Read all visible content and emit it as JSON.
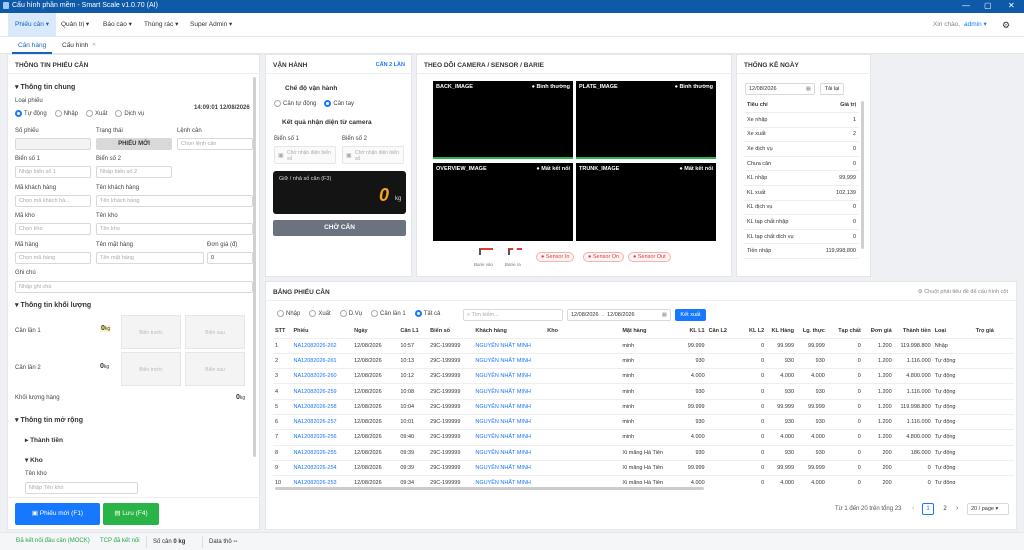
{
  "titlebar": {
    "title": "Cấu hình phần mềm - Smart Scale v1.0.70 (AI)",
    "min": "—",
    "max": "▢",
    "close": "✕"
  },
  "menu": {
    "items": [
      "Phiếu cân ▾",
      "Quản trị ▾",
      "Báo cáo ▾",
      "Thùng rác ▾",
      "Super Admin ▾"
    ],
    "greeting": "Xin chào,",
    "user": "admin ▾"
  },
  "tabs": {
    "items": [
      "Cân hàng",
      "Cấu hình"
    ],
    "close": "✕"
  },
  "left": {
    "title": "THÔNG TIN PHIẾU CÂN",
    "general": "Thông tin chung",
    "type_label": "Loại phiếu",
    "types": [
      "Tự động",
      "Nhập",
      "Xuất",
      "Dịch vụ"
    ],
    "datetime": "14:09:01 12/08/2026",
    "ticket_no_label": "Số phiếu",
    "status_label": "Trạng thái",
    "status_value": "PHIẾU MỚI",
    "cmd_label": "Lệnh cân",
    "cmd_ph": "Chọn lệnh cân",
    "plate1_label": "Biển số 1",
    "plate1_ph": "Nhập biển số 1",
    "plate2_label": "Biển số 2",
    "plate2_ph": "Nhập biển số 2",
    "cust_code_label": "Mã khách hàng",
    "cust_code_ph": "Chọn mã khách hà...",
    "cust_name_label": "Tên khách hàng",
    "cust_name_ph": "Tên khách hàng",
    "wh_code_label": "Mã kho",
    "wh_code_ph": "Chọn kho",
    "wh_name_label": "Tên kho",
    "wh_name_ph": "Tên kho",
    "goods_code_label": "Mã hàng",
    "goods_code_ph": "Chọn mã hàng",
    "goods_name_label": "Tên mặt hàng",
    "goods_name_ph": "Tên mặt hàng",
    "price_label": "Đơn giá (đ)",
    "price_value": "0",
    "note_label": "Ghi chú",
    "note_ph": "Nhập ghi chú",
    "weight_section": "Thông tin khối lượng",
    "w1_label": "Cân lần 1",
    "w1_value": "0",
    "w2_label": "Cân lần 2",
    "w2_value": "0",
    "unit": "kg",
    "bs_truoc": "Biển trước",
    "bs_sau": "Biển sau",
    "net_label": "Khối lượng hàng",
    "net_value": "0",
    "ext_section": "Thông tin mở rộng",
    "money": "Thành tiền",
    "kho": "Kho",
    "kho_name_label": "Tên kho",
    "kho_name_ph": "Nhập Tên kho",
    "new_btn": "Phiếu mới (F1)",
    "save_btn": "Lưu (F4)"
  },
  "op": {
    "title": "VẬN HÀNH",
    "mode_badge": "CÂN 2 LẦN",
    "mode_title": "Chế độ vận hành",
    "modes": [
      "Cân tự động",
      "Cân tay"
    ],
    "recog_title": "Kết quả nhận diện từ camera",
    "plate1": "Biển số 1",
    "plate2": "Biển số 2",
    "recog_ph": "Chờ nhận diện biển số",
    "hold_label": "Giữ / nhả số cân (F3)",
    "weight": "0",
    "unit": "kg",
    "wait_btn": "CHỜ CÂN"
  },
  "cams": {
    "title": "THEO DÕI CAMERA / SENSOR / BARIE",
    "items": [
      {
        "name": "BACK_IMAGE",
        "status": "● Bình thường"
      },
      {
        "name": "PLATE_IMAGE",
        "status": "● Bình thường"
      },
      {
        "name": "OVERVIEW_IMAGE",
        "status": "● Mất kết nối"
      },
      {
        "name": "TRUNK_IMAGE",
        "status": "● Mất kết nối"
      }
    ],
    "barrier_in": "Barie vào",
    "barrier_out": "Barie ra",
    "sensors": [
      "● Sensor In",
      "● Sensor On",
      "● Sensor Out"
    ]
  },
  "stats": {
    "title": "THỐNG KÊ NGÀY",
    "date": "12/08/2026",
    "reload": "Tải lại",
    "col1": "Tiêu chí",
    "col2": "Giá trị",
    "rows": [
      [
        "Xe nhập",
        "1"
      ],
      [
        "Xe xuất",
        "2"
      ],
      [
        "Xe dịch vụ",
        "0"
      ],
      [
        "Chưa cân",
        "0"
      ],
      [
        "KL nhập",
        "99,999"
      ],
      [
        "KL xuất",
        "102,139"
      ],
      [
        "KL dịch vụ",
        "0"
      ],
      [
        "KL tạp chất nhập",
        "0"
      ],
      [
        "KL tạp chất dịch vụ",
        "0"
      ],
      [
        "Tiền nhập",
        "119,998,800"
      ]
    ]
  },
  "grid": {
    "title": "BẢNG PHIẾU CÂN",
    "hint": "⚙ Chuột phải tiêu đề để cấu hình cột",
    "filters": [
      "Nhập",
      "Xuất",
      "D.Vụ",
      "Cân lần 1",
      "Tất cả"
    ],
    "search_ph": "Tìm kiếm...",
    "from": "12/08/2026",
    "to": "12/08/2026",
    "export": "Kết xuất",
    "headers": [
      "STT",
      "Phiếu",
      "Ngày",
      "Cân L1",
      "Biển số",
      "Khách hàng",
      "Kho",
      "Mặt hàng",
      "KL L1",
      "Cân L2",
      "KL L2",
      "KL Hàng",
      "Lg. thực",
      "Tạp chất",
      "Đơn giá",
      "Thành tiền",
      "Loại",
      "Trọ giá"
    ],
    "rows": [
      [
        "1",
        "NA12082026-262",
        "12/08/2026",
        "10:57",
        "29C-199999",
        "NGUYỄN NHẤT MINH",
        "",
        "minh",
        "99.999",
        "",
        "0",
        "99.999",
        "99.999",
        "0",
        "1.200",
        "119.998.800",
        "Nhập",
        ""
      ],
      [
        "2",
        "NA12082026-261",
        "12/08/2026",
        "10:13",
        "29C-199999",
        "NGUYỄN NHẤT MINH",
        "",
        "minh",
        "930",
        "",
        "0",
        "930",
        "930",
        "0",
        "1.200",
        "1.116.000",
        "Tự động",
        ""
      ],
      [
        "3",
        "NA12082026-260",
        "12/08/2026",
        "10:12",
        "29C-199999",
        "NGUYỄN NHẤT MINH",
        "",
        "minh",
        "4.000",
        "",
        "0",
        "4.000",
        "4.000",
        "0",
        "1.200",
        "4.800.000",
        "Tự động",
        ""
      ],
      [
        "4",
        "NA12082026-259",
        "12/08/2026",
        "10:08",
        "29C-199999",
        "NGUYỄN NHẤT MINH",
        "",
        "minh",
        "930",
        "",
        "0",
        "930",
        "930",
        "0",
        "1.200",
        "1.116.000",
        "Tự động",
        ""
      ],
      [
        "5",
        "NA12082026-258",
        "12/08/2026",
        "10:04",
        "29C-199999",
        "NGUYỄN NHẤT MINH",
        "",
        "minh",
        "99.999",
        "",
        "0",
        "99.999",
        "99.999",
        "0",
        "1.200",
        "119.998.800",
        "Tự động",
        ""
      ],
      [
        "6",
        "NA12082026-257",
        "12/08/2026",
        "10:01",
        "29C-199999",
        "NGUYỄN NHẤT MINH",
        "",
        "minh",
        "930",
        "",
        "0",
        "930",
        "930",
        "0",
        "1.200",
        "1.116.000",
        "Tự động",
        ""
      ],
      [
        "7",
        "NA12082026-256",
        "12/08/2026",
        "09:40",
        "29C-199999",
        "NGUYỄN NHẤT MINH",
        "",
        "minh",
        "4.000",
        "",
        "0",
        "4.000",
        "4.000",
        "0",
        "1.200",
        "4.800.000",
        "Tự động",
        ""
      ],
      [
        "8",
        "NA12082026-255",
        "12/08/2026",
        "09:39",
        "29C-199999",
        "NGUYỄN NHẤT MINH",
        "",
        "Xi măng Hà Tiên",
        "930",
        "",
        "0",
        "930",
        "930",
        "0",
        "200",
        "186.000",
        "Tự động",
        ""
      ],
      [
        "9",
        "NA12082026-254",
        "12/08/2026",
        "09:39",
        "29C-199999",
        "NGUYỄN NHẤT MINH",
        "",
        "Xi măng Hà Tiên",
        "99.999",
        "",
        "0",
        "99.999",
        "99.999",
        "0",
        "200",
        "0",
        "Tự động",
        ""
      ],
      [
        "10",
        "NA12082026-253",
        "12/08/2026",
        "09:34",
        "29C-199999",
        "NGUYỄN NHẤT MINH",
        "",
        "Xi măng Hà Tiên",
        "4.000",
        "",
        "0",
        "4.000",
        "4.000",
        "0",
        "200",
        "0",
        "Tự động",
        ""
      ]
    ],
    "pagination": {
      "summary": "Từ 1 đến 20 trên tổng 23",
      "prev": "‹",
      "pages": [
        "1",
        "2"
      ],
      "next": "›",
      "page_size": "20 / page ▾"
    }
  },
  "status": {
    "scale_conn": "Đã kết nối đầu cân (MOCK)",
    "tcp": "TCP đã kết nối",
    "weight_label": "Số cân",
    "weight": "0 kg",
    "raw_label": "Data thô",
    "raw": "--"
  }
}
